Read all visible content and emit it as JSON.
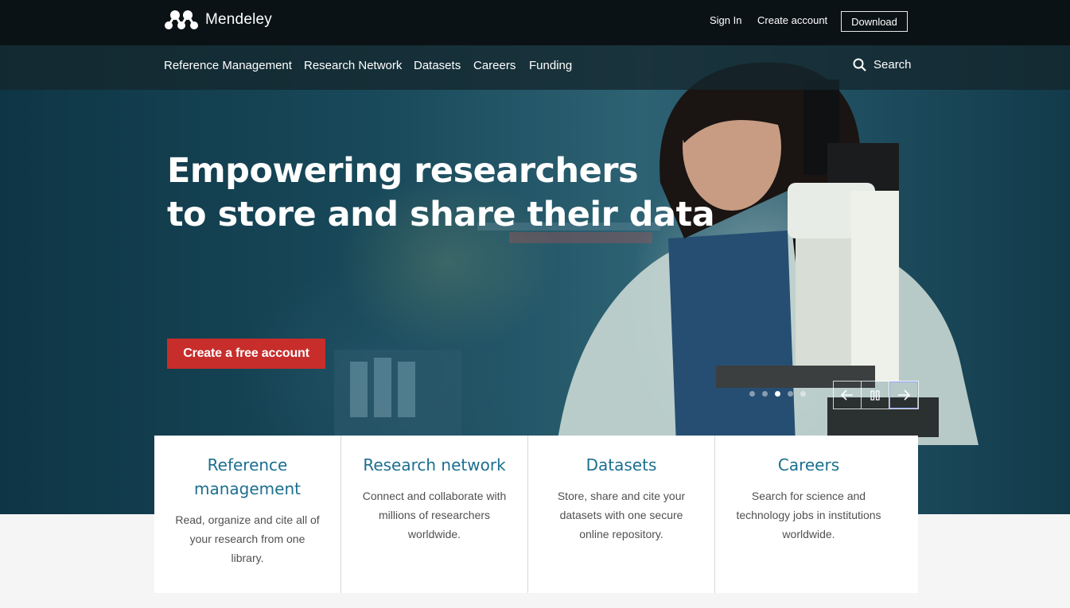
{
  "brand": {
    "name": "Mendeley",
    "logo_icon": "mendeley-logo-icon"
  },
  "topbar": {
    "sign_in": "Sign In",
    "create_account": "Create account",
    "download": "Download"
  },
  "nav": {
    "items": [
      {
        "label": "Reference Management"
      },
      {
        "label": "Research Network"
      },
      {
        "label": "Datasets"
      },
      {
        "label": "Careers"
      },
      {
        "label": "Funding"
      }
    ],
    "search_label": "Search"
  },
  "hero": {
    "headline_line1": "Empowering researchers",
    "headline_line2": "to store and share their data",
    "cta_label": "Create a free account",
    "slide_count": 5,
    "active_slide": 3
  },
  "cards": [
    {
      "title": "Reference management",
      "description": "Read, organize and cite all of your research from one library."
    },
    {
      "title": "Research network",
      "description": "Connect and collaborate with millions of researchers worldwide."
    },
    {
      "title": "Datasets",
      "description": "Store, share and cite your datasets with one secure online repository."
    },
    {
      "title": "Careers",
      "description": "Search for science and technology jobs in institutions worldwide."
    }
  ],
  "colors": {
    "topbar_bg": "#0b1215",
    "cta_red": "#c72d2b",
    "card_title_blue": "#1b6f8e",
    "hero_teal": "#18495a"
  }
}
